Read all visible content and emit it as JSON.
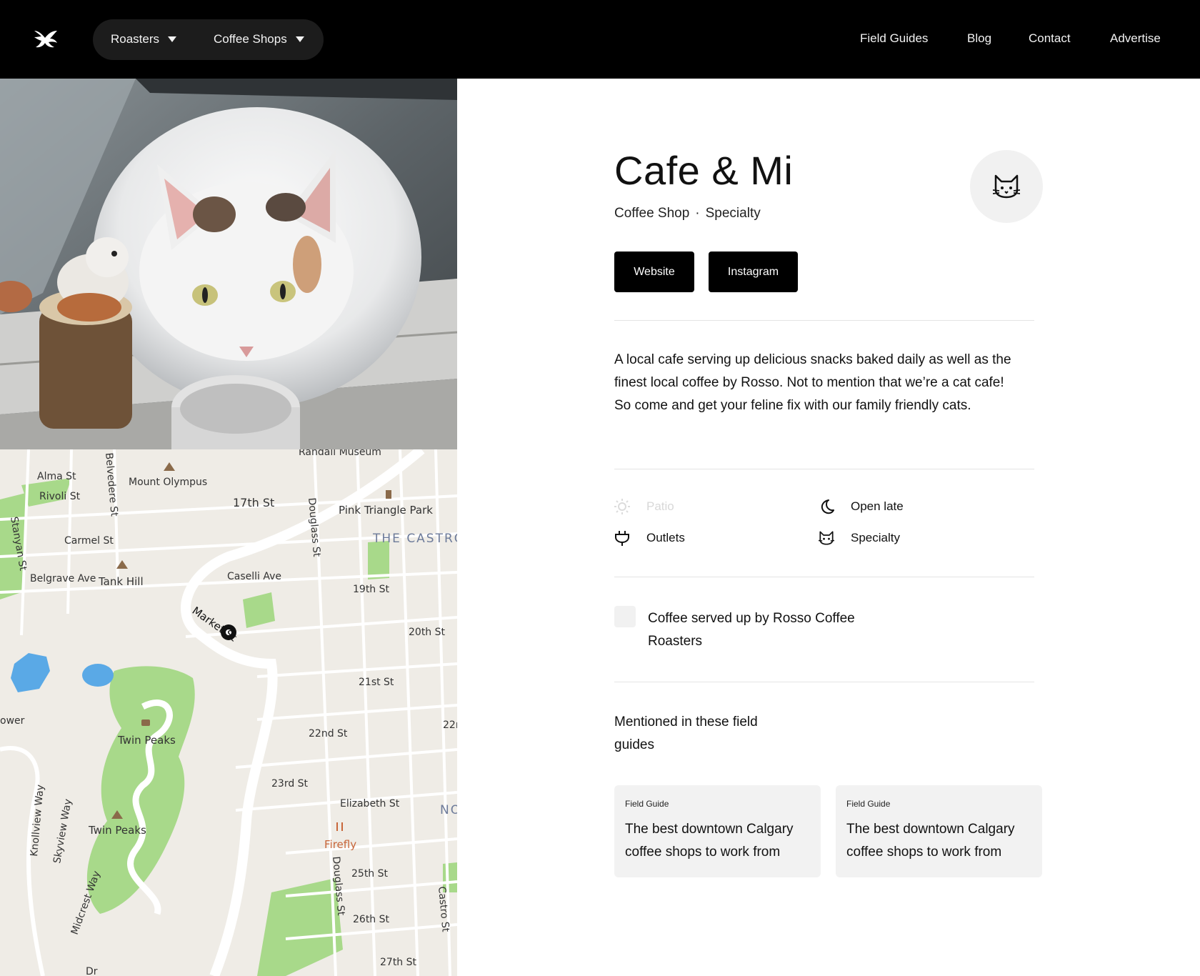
{
  "nav": {
    "roasters_label": "Roasters",
    "coffee_shops_label": "Coffee Shops",
    "links": [
      "Field Guides",
      "Blog",
      "Contact",
      "Advertise"
    ]
  },
  "shop": {
    "name": "Cafe & Mi",
    "category": "Coffee Shop",
    "separator": "·",
    "tag": "Specialty",
    "website_label": "Website",
    "instagram_label": "Instagram",
    "description": "A local cafe serving up delicious snacks baked daily as well as the finest local coffee by Rosso. Not to mention that we’re a cat cafe! So come and get your feline fix with our family friendly cats."
  },
  "amenities": [
    {
      "label": "Patio",
      "icon": "sun-icon",
      "available": false
    },
    {
      "label": "Open late",
      "icon": "moon-icon",
      "available": true
    },
    {
      "label": "Outlets",
      "icon": "plug-icon",
      "available": true
    },
    {
      "label": "Specialty",
      "icon": "cat-icon",
      "available": true
    }
  ],
  "roaster": {
    "text": "Coffee served up by Rosso Coffee Roasters"
  },
  "field_guides": {
    "heading": "Mentioned in these field guides",
    "cards": [
      {
        "kicker": "Field Guide",
        "title": "The best downtown Calgary coffee shops to work from"
      },
      {
        "kicker": "Field Guide",
        "title": "The best downtown Calgary coffee shops to work from"
      }
    ]
  },
  "map": {
    "labels": [
      "Stanyan St",
      "Alma St",
      "Rivoli St",
      "Belvedere St",
      "Mount Olympus",
      "17th St",
      "Douglass St",
      "Pink Triangle Park",
      "THE CASTRO",
      "Randall Museum",
      "Carmel St",
      "Belgrave Ave",
      "Tank Hill",
      "Caselli Ave",
      "19th St",
      "Market St",
      "20th St",
      "21st St",
      "Twin Peaks",
      "22nd St",
      "22n",
      "23rd St",
      "Elizabeth St",
      "NO",
      "Firefly",
      "Twin Peaks",
      "Knollview Way",
      "Skyview Way",
      "Midcrest Way",
      "25th St",
      "Douglass St",
      "Castro St",
      "26th St",
      "27th St",
      "ower",
      "Dr"
    ]
  },
  "colors": {
    "header_bg": "#000000",
    "pill_bg": "#1c1c1c",
    "button_bg": "#000000",
    "card_bg": "#f2f2f2",
    "map_park": "#a8d98a",
    "map_water": "#5aa9e6",
    "map_poi": "#c8663a"
  }
}
